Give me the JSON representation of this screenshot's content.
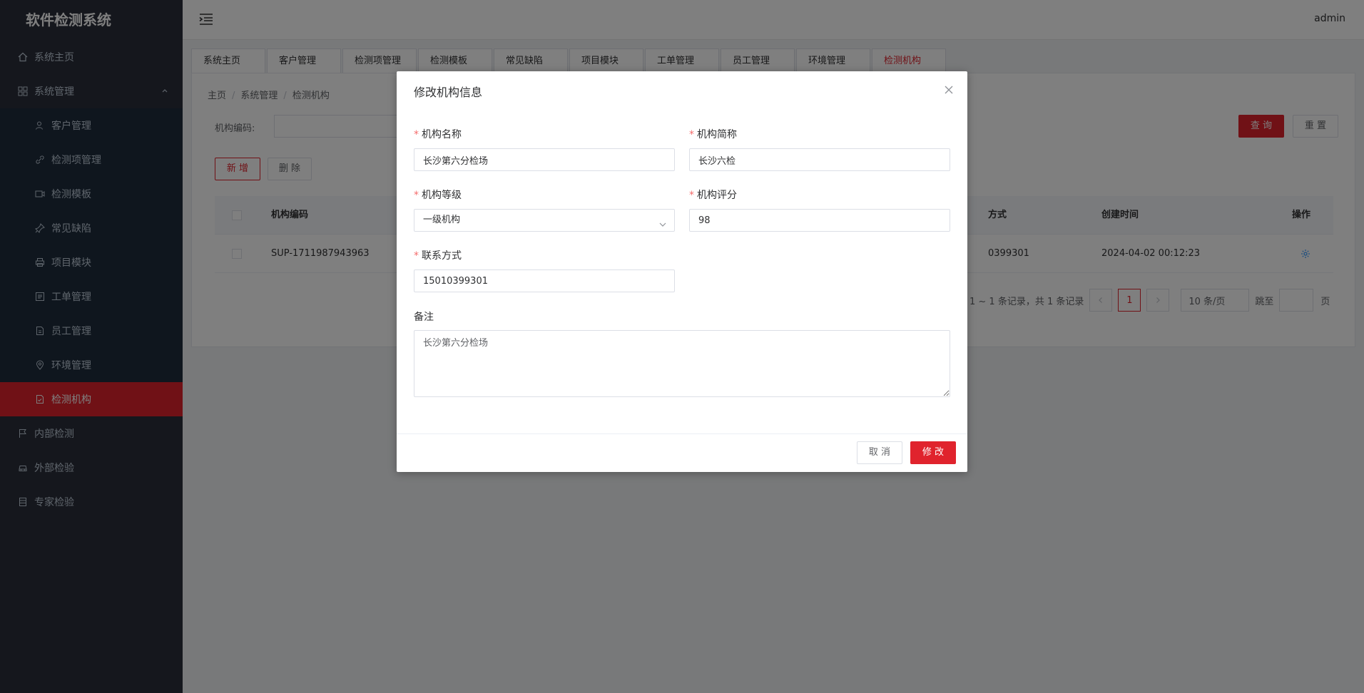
{
  "app": {
    "title": "软件检测系统",
    "user": "admin"
  },
  "sidebar": {
    "items": [
      {
        "label": "系统主页",
        "icon": "home-icon"
      },
      {
        "label": "系统管理",
        "icon": "grid-icon",
        "expanded": true
      },
      {
        "label": "客户管理",
        "icon": "user-icon"
      },
      {
        "label": "检测项管理",
        "icon": "link-icon"
      },
      {
        "label": "检测模板",
        "icon": "video-icon"
      },
      {
        "label": "常见缺陷",
        "icon": "pin-icon"
      },
      {
        "label": "项目模块",
        "icon": "printer-icon"
      },
      {
        "label": "工单管理",
        "icon": "ticket-icon"
      },
      {
        "label": "员工管理",
        "icon": "document-icon"
      },
      {
        "label": "环境管理",
        "icon": "location-icon"
      },
      {
        "label": "检测机构",
        "icon": "document-check-icon",
        "active": true
      },
      {
        "label": "内部检测",
        "icon": "flag-icon"
      },
      {
        "label": "外部检验",
        "icon": "car-icon"
      },
      {
        "label": "专家检验",
        "icon": "list-icon"
      }
    ]
  },
  "tabs": [
    {
      "label": "系统主页"
    },
    {
      "label": "客户管理"
    },
    {
      "label": "检测项管理"
    },
    {
      "label": "检测模板"
    },
    {
      "label": "常见缺陷"
    },
    {
      "label": "项目模块"
    },
    {
      "label": "工单管理"
    },
    {
      "label": "员工管理"
    },
    {
      "label": "环境管理"
    },
    {
      "label": "检测机构",
      "active": true
    }
  ],
  "breadcrumb": [
    "主页",
    "系统管理",
    "检测机构"
  ],
  "query": {
    "code_label": "机构编码:",
    "search_btn": "查 询",
    "reset_btn": "重 置"
  },
  "actions": {
    "add": "新 增",
    "delete": "删 除"
  },
  "table": {
    "headers": {
      "code": "机构编码",
      "contact": "方式",
      "created": "创建时间",
      "ops": "操作"
    },
    "rows": [
      {
        "code": "SUP-1711987943963",
        "contact": "0399301",
        "created": "2024-04-02 00:12:23"
      }
    ]
  },
  "pagination": {
    "summary": "1 ~ 1 条记录，共 1 条记录",
    "current": "1",
    "page_size": "10 条/页",
    "jump_label": "跳至",
    "page_suffix": "页"
  },
  "dialog": {
    "title": "修改机构信息",
    "fields": {
      "name": {
        "label": "机构名称",
        "value": "长沙第六分检场"
      },
      "short": {
        "label": "机构简称",
        "value": "长沙六检"
      },
      "level": {
        "label": "机构等级",
        "value": "一级机构"
      },
      "score": {
        "label": "机构评分",
        "value": "98"
      },
      "contact": {
        "label": "联系方式",
        "value": "15010399301"
      },
      "remark": {
        "label": "备注",
        "value": "长沙第六分检场"
      }
    },
    "cancel": "取 消",
    "submit": "修 改"
  },
  "colors": {
    "accent": "#e0232d",
    "sidebar_bg": "#2b2f3a"
  }
}
